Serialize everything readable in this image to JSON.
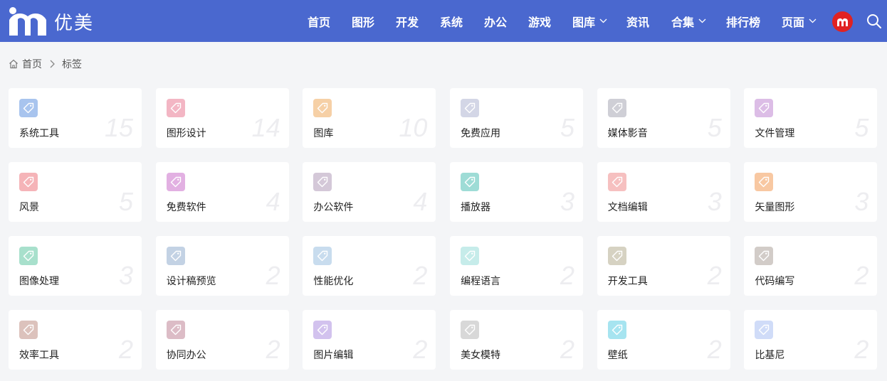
{
  "brand": {
    "name": "优美"
  },
  "nav": {
    "items": [
      {
        "label": "首页",
        "dropdown": false
      },
      {
        "label": "图形",
        "dropdown": false
      },
      {
        "label": "开发",
        "dropdown": false
      },
      {
        "label": "系统",
        "dropdown": false
      },
      {
        "label": "办公",
        "dropdown": false
      },
      {
        "label": "游戏",
        "dropdown": false
      },
      {
        "label": "图库",
        "dropdown": true
      },
      {
        "label": "资讯",
        "dropdown": false
      },
      {
        "label": "合集",
        "dropdown": true
      },
      {
        "label": "排行榜",
        "dropdown": false
      },
      {
        "label": "页面",
        "dropdown": true
      }
    ]
  },
  "breadcrumb": {
    "home": "首页",
    "current": "标签"
  },
  "tags": [
    {
      "name": "系统工具",
      "count": "15",
      "color": "#a8c4ee"
    },
    {
      "name": "图形设计",
      "count": "14",
      "color": "#f3b6c4"
    },
    {
      "name": "图库",
      "count": "10",
      "color": "#f6d0a6"
    },
    {
      "name": "免费应用",
      "count": "5",
      "color": "#d3d6e6"
    },
    {
      "name": "媒体影音",
      "count": "5",
      "color": "#cfcfd6"
    },
    {
      "name": "文件管理",
      "count": "5",
      "color": "#dcbde6"
    },
    {
      "name": "风景",
      "count": "5",
      "color": "#f5b4b8"
    },
    {
      "name": "免费软件",
      "count": "4",
      "color": "#e2b0e2"
    },
    {
      "name": "办公软件",
      "count": "4",
      "color": "#d4c8d8"
    },
    {
      "name": "播放器",
      "count": "3",
      "color": "#9edcd6"
    },
    {
      "name": "文档编辑",
      "count": "3",
      "color": "#f6c0c0"
    },
    {
      "name": "矢量图形",
      "count": "3",
      "color": "#f8c8a2"
    },
    {
      "name": "图像处理",
      "count": "3",
      "color": "#a8e0cc"
    },
    {
      "name": "设计稿预览",
      "count": "2",
      "color": "#c3d2e4"
    },
    {
      "name": "性能优化",
      "count": "2",
      "color": "#c8dcee"
    },
    {
      "name": "编程语言",
      "count": "2",
      "color": "#c6ecea"
    },
    {
      "name": "开发工具",
      "count": "2",
      "color": "#d6d2c2"
    },
    {
      "name": "代码编写",
      "count": "2",
      "color": "#d2ccc8"
    },
    {
      "name": "效率工具",
      "count": "2",
      "color": "#dcc2bc"
    },
    {
      "name": "协同办公",
      "count": "2",
      "color": "#dcbcc6"
    },
    {
      "name": "图片编辑",
      "count": "2",
      "color": "#d2c2ee"
    },
    {
      "name": "美女模特",
      "count": "2",
      "color": "#d8d8d8"
    },
    {
      "name": "壁纸",
      "count": "2",
      "color": "#a6e4f0"
    },
    {
      "name": "比基尼",
      "count": "2",
      "color": "#d0dcf8"
    }
  ]
}
